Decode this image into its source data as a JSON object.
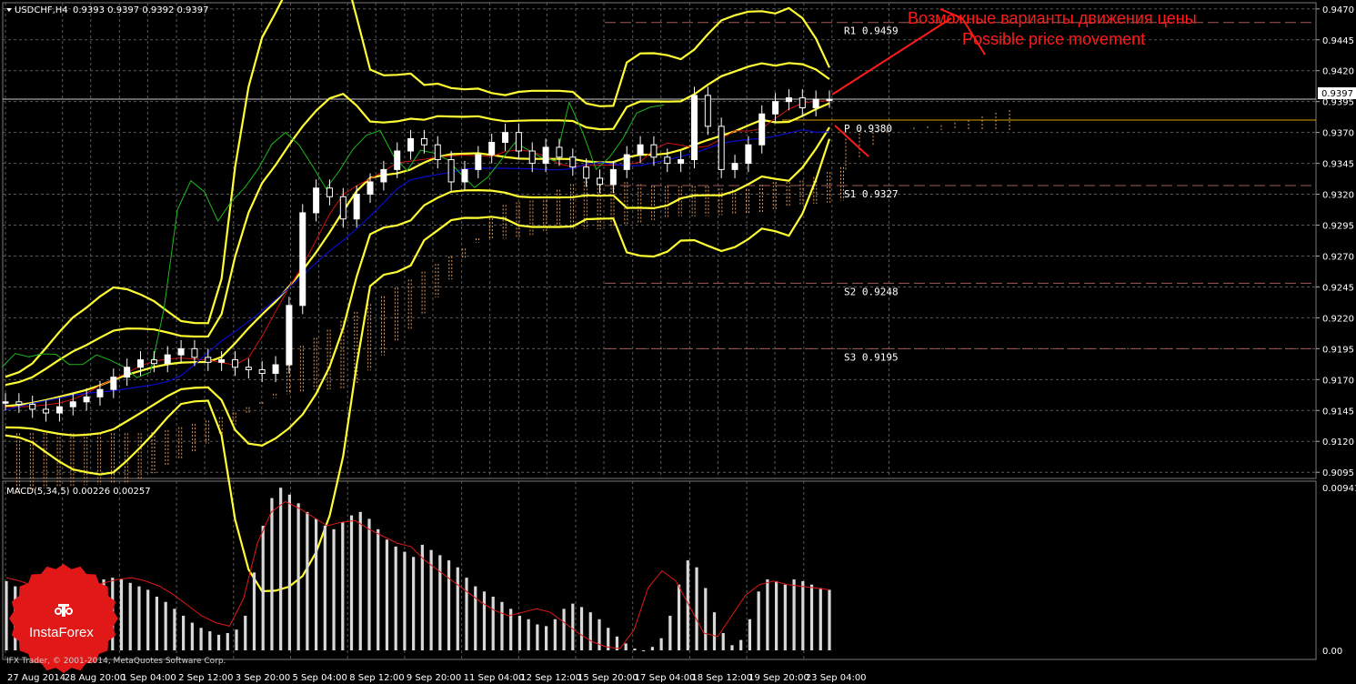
{
  "header": {
    "symbol": "USDCHF,H4",
    "ohlc": "0.9393 0.9397 0.9392 0.9397"
  },
  "macd_label": "MACD(5,34,5) 0.00226 0.00257",
  "annotation": {
    "line1": "Возможные варианты движения цены",
    "line2": "Possible price movement",
    "color": "#ff1a1a"
  },
  "copyright": "IFX Trader, © 2001-2014, MetaQuotes Software Corp.",
  "logo": {
    "name": "InstaForex",
    "color": "#e01818"
  },
  "current_price_label": "0.9397",
  "macd_axis": {
    "top_label": "0.00941",
    "zero_label": "0.00"
  },
  "colors": {
    "background": "#000000",
    "grid": "#5a5a5a",
    "bullish": "#ffffff",
    "bearish": "#000000",
    "bollinger": "#ffff33",
    "kijun": "#0a0ad0",
    "tenkan": "#d01010",
    "chikou": "#1cb81c",
    "cloud": "#e09a5a",
    "levels": "#a05a5a",
    "macd_hist": "#d8d8d8",
    "macd_signal": "#e01818"
  },
  "chart_data": {
    "type": "candlestick",
    "title": "USDCHF,H4",
    "ylim": [
      0.909,
      0.9475
    ],
    "y_ticks": [
      "0.9470",
      "0.9445",
      "0.9420",
      "0.9395",
      "0.9370",
      "0.9345",
      "0.9320",
      "0.9295",
      "0.9270",
      "0.9245",
      "0.9220",
      "0.9195",
      "0.9170",
      "0.9145",
      "0.9120",
      "0.9095"
    ],
    "x_ticks": [
      "27 Aug 2014",
      "28 Aug 20:00",
      "1 Sep 04:00",
      "2 Sep 12:00",
      "3 Sep 20:00",
      "5 Sep 04:00",
      "8 Sep 12:00",
      "9 Sep 20:00",
      "11 Sep 04:00",
      "12 Sep 12:00",
      "15 Sep 20:00",
      "17 Sep 04:00",
      "18 Sep 12:00",
      "19 Sep 20:00",
      "23 Sep 04:00"
    ],
    "pivot_levels": [
      {
        "name": "R1",
        "value": 0.9459,
        "label": "R1  0.9459"
      },
      {
        "name": "P",
        "value": 0.938,
        "label": "P  0.9380"
      },
      {
        "name": "S1",
        "value": 0.9327,
        "label": "S1  0.9327"
      },
      {
        "name": "S2",
        "value": 0.9248,
        "label": "S2  0.9248"
      },
      {
        "name": "S3",
        "value": 0.9195,
        "label": "S3  0.9195"
      }
    ],
    "price_trace": [
      0.9152,
      0.915,
      0.9146,
      0.9143,
      0.9148,
      0.9152,
      0.9156,
      0.9162,
      0.9172,
      0.918,
      0.9186,
      0.9183,
      0.919,
      0.9195,
      0.9188,
      0.9184,
      0.9186,
      0.918,
      0.9178,
      0.9175,
      0.9182,
      0.923,
      0.9305,
      0.9325,
      0.9318,
      0.93,
      0.932,
      0.933,
      0.934,
      0.9355,
      0.9365,
      0.936,
      0.9348,
      0.933,
      0.934,
      0.9352,
      0.9362,
      0.937,
      0.9355,
      0.9345,
      0.9358,
      0.935,
      0.9342,
      0.9333,
      0.9328,
      0.934,
      0.9352,
      0.936,
      0.935,
      0.9345,
      0.9348,
      0.94,
      0.9375,
      0.934,
      0.9345,
      0.936,
      0.9385,
      0.9395,
      0.9398,
      0.939,
      0.9397,
      0.9397
    ],
    "macd": {
      "label": "MACD(5,34,5)",
      "main": 0.00226,
      "signal": 0.00257,
      "ylim": [
        -0.0005,
        0.00941
      ],
      "histogram": [
        0.004,
        0.0037,
        0.0035,
        0.0033,
        0.003,
        0.0032,
        0.0034,
        0.0036,
        0.0037,
        0.0039,
        0.004,
        0.0041,
        0.0042,
        0.0041,
        0.0039,
        0.0037,
        0.0035,
        0.0031,
        0.0028,
        0.0024,
        0.002,
        0.0016,
        0.0013,
        0.0011,
        0.0009,
        0.001,
        0.0012,
        0.002,
        0.0045,
        0.0072,
        0.0088,
        0.0094,
        0.009,
        0.0085,
        0.008,
        0.0076,
        0.0072,
        0.007,
        0.0074,
        0.0078,
        0.008,
        0.0076,
        0.007,
        0.0064,
        0.006,
        0.0057,
        0.0054,
        0.0061,
        0.0058,
        0.0055,
        0.0052,
        0.0048,
        0.0042,
        0.0037,
        0.0034,
        0.0031,
        0.0028,
        0.0024,
        0.002,
        0.0018,
        0.0015,
        0.0014,
        0.0018,
        0.0024,
        0.0027,
        0.0025,
        0.0022,
        0.0018,
        0.0013,
        0.0008,
        0.0004,
        0.0001,
        0.0,
        0.0002,
        0.0007,
        0.002,
        0.0038,
        0.0052,
        0.0048,
        0.0036,
        0.0022,
        0.001,
        0.0003,
        0.0006,
        0.0018,
        0.0034,
        0.0041,
        0.004,
        0.0038,
        0.0041,
        0.004,
        0.0038,
        0.0036,
        0.0035
      ],
      "signal_trace": [
        0.0042,
        0.004,
        0.0037,
        0.0035,
        0.0034,
        0.0035,
        0.0037,
        0.0039,
        0.0041,
        0.0042,
        0.004,
        0.0037,
        0.0032,
        0.0026,
        0.002,
        0.0016,
        0.0014,
        0.003,
        0.0062,
        0.008,
        0.0086,
        0.0082,
        0.0077,
        0.0072,
        0.0074,
        0.0075,
        0.007,
        0.0066,
        0.0062,
        0.006,
        0.0052,
        0.0046,
        0.004,
        0.0034,
        0.0028,
        0.0023,
        0.002,
        0.0022,
        0.0024,
        0.0022,
        0.0016,
        0.001,
        0.0005,
        0.0002,
        0.0001,
        0.0012,
        0.0036,
        0.0046,
        0.004,
        0.0025,
        0.001,
        0.0008,
        0.002,
        0.0032,
        0.0038,
        0.004,
        0.0038,
        0.0037,
        0.0036,
        0.0035
      ]
    }
  }
}
